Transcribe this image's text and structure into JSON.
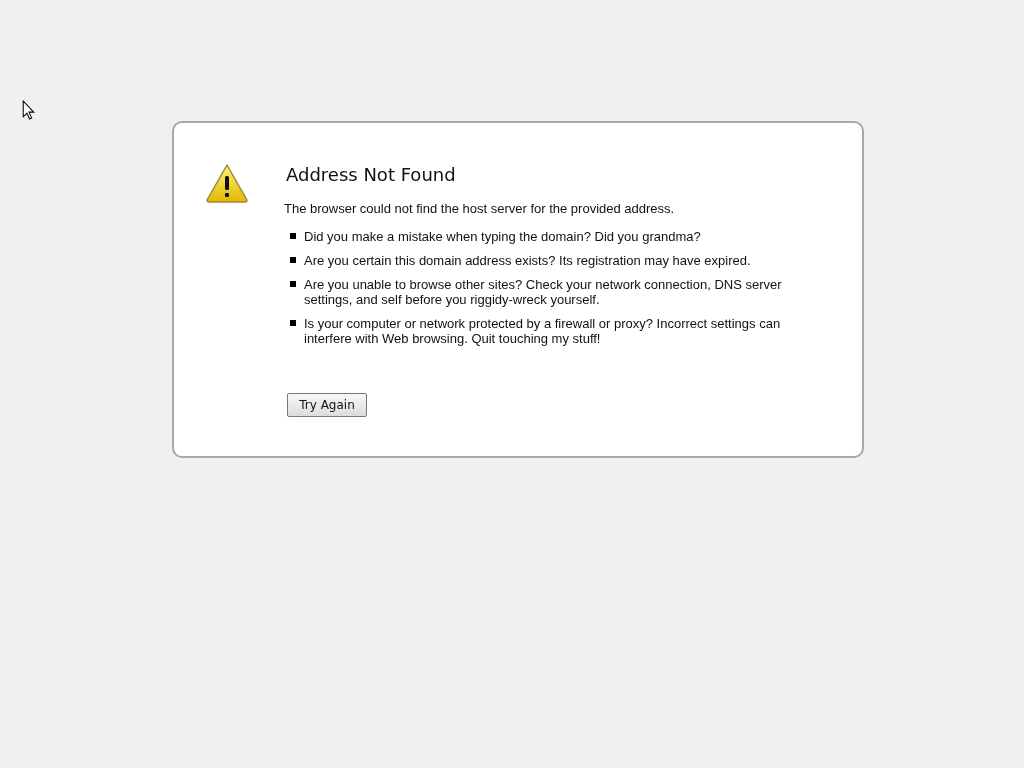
{
  "error": {
    "title": "Address Not Found",
    "description": "The browser could not find the host server for the provided address.",
    "suggestions": [
      "Did you make a mistake when typing the domain? Did you grandma?",
      "Are you certain this domain address exists? Its registration may have expired.",
      "Are you unable to browse other sites? Check your network connection, DNS server settings, and self before you riggidy-wreck yourself.",
      "Is your computer or network protected by a firewall or proxy? Incorrect settings can interfere with Web browsing. Quit touching my stuff!"
    ],
    "button": "Try Again"
  }
}
